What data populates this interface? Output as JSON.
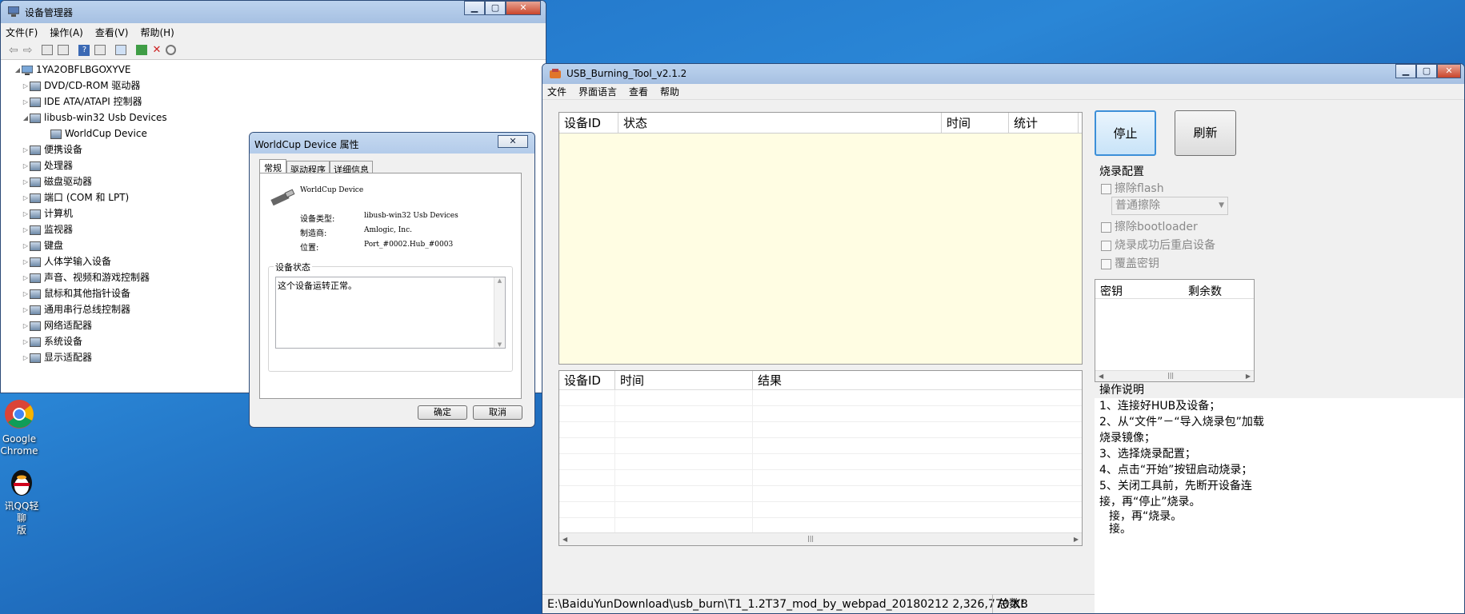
{
  "device_manager": {
    "title": "设备管理器",
    "menu": [
      "文件(F)",
      "操作(A)",
      "查看(V)",
      "帮助(H)"
    ],
    "root": "1YA2OBFLBGOXYVE",
    "nodes": [
      {
        "label": "DVD/CD-ROM 驱动器",
        "icon": "dvd-icon"
      },
      {
        "label": "IDE ATA/ATAPI 控制器",
        "icon": "ide-controller-icon"
      },
      {
        "label": "libusb-win32 Usb Devices",
        "icon": "usb-icon"
      },
      {
        "label": "WorldCup Device",
        "icon": "usb-device-icon"
      },
      {
        "label": "便携设备",
        "icon": "portable-device-icon"
      },
      {
        "label": "处理器",
        "icon": "processor-icon"
      },
      {
        "label": "磁盘驱动器",
        "icon": "disk-drive-icon"
      },
      {
        "label": "端口 (COM 和 LPT)",
        "icon": "port-icon"
      },
      {
        "label": "计算机",
        "icon": "computer-icon"
      },
      {
        "label": "监视器",
        "icon": "monitor-icon"
      },
      {
        "label": "键盘",
        "icon": "keyboard-icon"
      },
      {
        "label": "人体学输入设备",
        "icon": "hid-icon"
      },
      {
        "label": "声音、视频和游戏控制器",
        "icon": "sound-icon"
      },
      {
        "label": "鼠标和其他指针设备",
        "icon": "mouse-icon"
      },
      {
        "label": "通用串行总线控制器",
        "icon": "usb-controller-icon"
      },
      {
        "label": "网络适配器",
        "icon": "network-icon"
      },
      {
        "label": "系统设备",
        "icon": "system-icon"
      },
      {
        "label": "显示适配器",
        "icon": "display-adapter-icon"
      }
    ]
  },
  "props": {
    "title": "WorldCup Device 属性",
    "tabs": [
      "常规",
      "驱动程序",
      "详细信息"
    ],
    "device_name": "WorldCup Device",
    "type_label": "设备类型:",
    "type_value": "libusb-win32 Usb Devices",
    "mfr_label": "制造商:",
    "mfr_value": "Amlogic, Inc.",
    "loc_label": "位置:",
    "loc_value": "Port_#0002.Hub_#0003",
    "status_group": "设备状态",
    "status_text": "这个设备运转正常。",
    "ok": "确定",
    "cancel": "取消"
  },
  "burn": {
    "title": "USB_Burning_Tool_v2.1.2",
    "menu": [
      "文件",
      "界面语言",
      "查看",
      "帮助"
    ],
    "cols_top": [
      "设备ID",
      "状态",
      "时间",
      "统计"
    ],
    "cols_bottom": [
      "设备ID",
      "时间",
      "结果"
    ],
    "stop": "停止",
    "refresh": "刷新",
    "config_title": "烧录配置",
    "erase_flash": "擦除flash",
    "erase_mode": "普通擦除",
    "erase_bootloader": "擦除bootloader",
    "reboot_after": "烧录成功后重启设备",
    "overwrite_key": "覆盖密钥",
    "key_cols": [
      "密钥",
      "剩余数"
    ],
    "instr_title": "操作说明",
    "instr_lines": [
      "1、连接好HUB及设备；",
      "2、从“文件”－“导入烧录包”加载",
      "烧录镜像；",
      "3、选择烧录配置；",
      "4、点击“开始”按钮启动烧录；",
      "5、关闭工具前，先断开设备连",
      "接，再“停止”烧录。"
    ],
    "instr_tail": [
      "接，再“烧录。",
      "接。"
    ],
    "status_path": "E:\\BaiduYunDownload\\usb_burn\\T1_1.2T37_mod_by_webpad_20180212  2,326,770 KB",
    "total_label": "总数："
  },
  "desktop": {
    "chrome_label": [
      "Google",
      "Chrome"
    ],
    "qq_label": [
      "讯QQ轻聊",
      "版"
    ]
  },
  "colors": {
    "list_bg": "#fffde3",
    "titlebar": "#b3cbea",
    "stop_border": "#3c8fd8"
  }
}
